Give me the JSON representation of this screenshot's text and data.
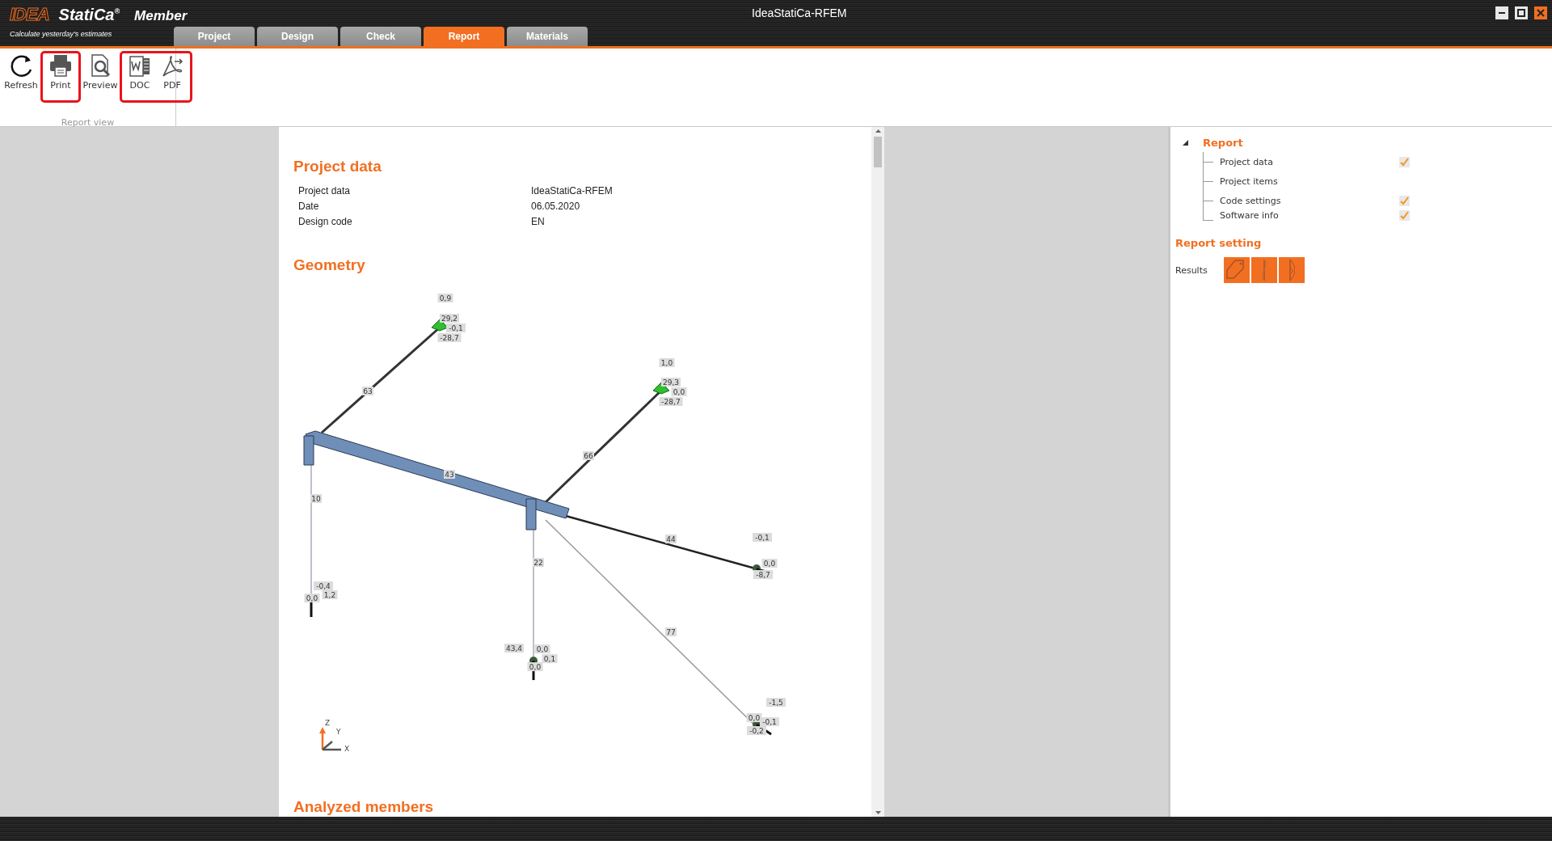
{
  "window": {
    "title": "IdeaStatiCa-RFEM"
  },
  "app": {
    "logo": "IDEA",
    "product": "StatiCa$^{®}$",
    "module": "Member",
    "tagline": "Calculate yesterday's estimates"
  },
  "tabs": [
    {
      "label": "Project",
      "selected": false
    },
    {
      "label": "Design",
      "selected": false
    },
    {
      "label": "Check",
      "selected": false
    },
    {
      "label": "Report",
      "selected": true
    },
    {
      "label": "Materials",
      "selected": false
    }
  ],
  "ribbon": {
    "group_label": "Report view",
    "buttons": [
      {
        "kind": "refresh",
        "label": "Refresh",
        "marked": false
      },
      {
        "kind": "print",
        "label": "Print",
        "marked": true
      },
      {
        "kind": "preview",
        "label": "Preview",
        "marked": false
      },
      {
        "kind": "doc",
        "label": "DOC",
        "marked": true
      },
      {
        "kind": "pdf",
        "label": "PDF",
        "marked": true
      }
    ]
  },
  "document": {
    "sections": [
      {
        "kind": "table",
        "title": "Project data",
        "rows": [
          {
            "label": "Project data",
            "value": "IdeaStatiCa-RFEM"
          },
          {
            "label": "Date",
            "value": "06.05.2020"
          },
          {
            "label": "Design code",
            "value": "EN"
          }
        ]
      },
      {
        "kind": "drawing",
        "title": "Geometry",
        "labels": [
          "0,9",
          "29,2",
          "-0,1",
          "-28,7",
          "63",
          "1,0",
          "29,3",
          "0,0",
          "-28,7",
          "66",
          "43",
          "10",
          "44",
          "-0,1",
          "0,0",
          "-8,7",
          "-0,4",
          "1,2",
          "0,0",
          "22",
          "43,4",
          "0,0",
          "0,1",
          "0,0",
          "77",
          "-1,5",
          "0,0",
          "-0,1",
          "-0,2"
        ],
        "axes": [
          "Z",
          "Y",
          "X"
        ]
      },
      {
        "kind": "heading",
        "title": "Analyzed members"
      }
    ]
  },
  "report_tree": {
    "title": "Report",
    "expanded": true,
    "children": [
      {
        "label": "Project data",
        "checked": true
      },
      {
        "label": "Project items",
        "checked": false
      },
      {
        "label": "Code settings",
        "checked": true
      },
      {
        "label": "Software info",
        "checked": true
      }
    ]
  },
  "report_setting": {
    "title": "Report setting",
    "results_label": "Results",
    "result_buttons": [
      {
        "kind": "section"
      },
      {
        "kind": "diagram"
      },
      {
        "kind": "deflection"
      }
    ]
  }
}
